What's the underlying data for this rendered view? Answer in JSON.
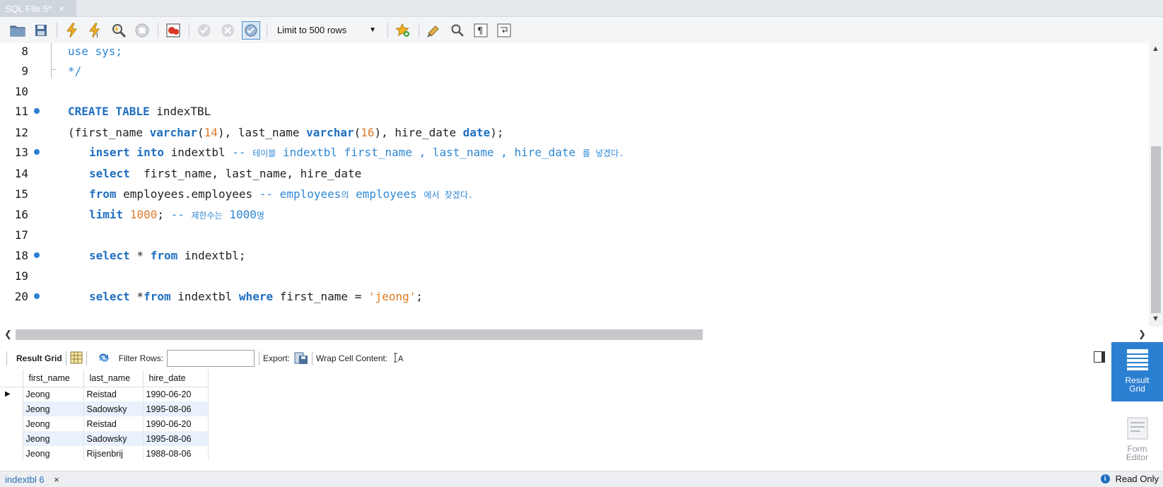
{
  "tab": {
    "title": "SQL File 5*",
    "close": "×"
  },
  "toolbar": {
    "limit_select": "Limit to 500 rows"
  },
  "editor": {
    "lines": [
      {
        "n": "8"
      },
      {
        "n": "9"
      },
      {
        "n": "10"
      },
      {
        "n": "11"
      },
      {
        "n": "12"
      },
      {
        "n": "13"
      },
      {
        "n": "14"
      },
      {
        "n": "15"
      },
      {
        "n": "16"
      },
      {
        "n": "17"
      },
      {
        "n": "18"
      },
      {
        "n": "19"
      },
      {
        "n": "20"
      }
    ],
    "code": {
      "l8": "use sys;",
      "l9": "*/",
      "l11_kw": "CREATE TABLE",
      "l11_rest": " indexTBL",
      "l12_a": "(first_name ",
      "l12_t1": "varchar",
      "l12_b": "(",
      "l12_n1": "14",
      "l12_c": "), last_name ",
      "l12_t2": "varchar",
      "l12_d": "(",
      "l12_n2": "16",
      "l12_e": "), hire_date ",
      "l12_t3": "date",
      "l12_f": ");",
      "l13_kw": "insert into",
      "l13_rest": " indextbl ",
      "l13_cm1": "-- ",
      "l13_cmk1": "테이블",
      "l13_cm2": " indextbl first_name , last_name , hire_date ",
      "l13_cmk2": "를 넣겠다.",
      "l14_kw": "select",
      "l14_rest": "  first_name, last_name, hire_date",
      "l15_kw": "from",
      "l15_rest": " employees.employees ",
      "l15_cm1": "-- employees",
      "l15_cmk1": "의",
      "l15_cm2": " employees ",
      "l15_cmk2": "에서 찾겠다.",
      "l16_kw": "limit",
      "l16_sp": " ",
      "l16_num": "1000",
      "l16_semi": "; ",
      "l16_cm1": "-- ",
      "l16_cmk1": "제한수는",
      "l16_cm2": " 1000",
      "l16_cmk2": "명",
      "l18_kw1": "select",
      "l18_a": " * ",
      "l18_kw2": "from",
      "l18_b": " indextbl;",
      "l20_kw1": "select",
      "l20_a": " *",
      "l20_kw2": "from",
      "l20_b": " indextbl ",
      "l20_kw3": "where",
      "l20_c": " first_name = ",
      "l20_str": "'jeong'",
      "l20_d": ";"
    }
  },
  "result_bar": {
    "result_grid": "Result Grid",
    "filter_rows": "Filter Rows:",
    "filter_value": "",
    "export": "Export:",
    "wrap": "Wrap Cell Content:"
  },
  "grid": {
    "columns": [
      "first_name",
      "last_name",
      "hire_date"
    ],
    "rows": [
      [
        "Jeong",
        "Reistad",
        "1990-06-20"
      ],
      [
        "Jeong",
        "Sadowsky",
        "1995-08-06"
      ],
      [
        "Jeong",
        "Reistad",
        "1990-06-20"
      ],
      [
        "Jeong",
        "Sadowsky",
        "1995-08-06"
      ],
      [
        "Jeong",
        "Rijsenbrij",
        "1988-08-06"
      ]
    ],
    "current_row_marker": "▶"
  },
  "side_panel": {
    "result_grid_label_1": "Result",
    "result_grid_label_2": "Grid",
    "form_editor_label_1": "Form",
    "form_editor_label_2": "Editor"
  },
  "status": {
    "tab": "indextbl 6",
    "close": "×",
    "info_icon": "i",
    "read_only": "Read Only"
  },
  "colors": {
    "keyword": "#1f6fc1",
    "number": "#de7a2a",
    "comment": "#2e87d4",
    "accent": "#2b7fd1"
  }
}
